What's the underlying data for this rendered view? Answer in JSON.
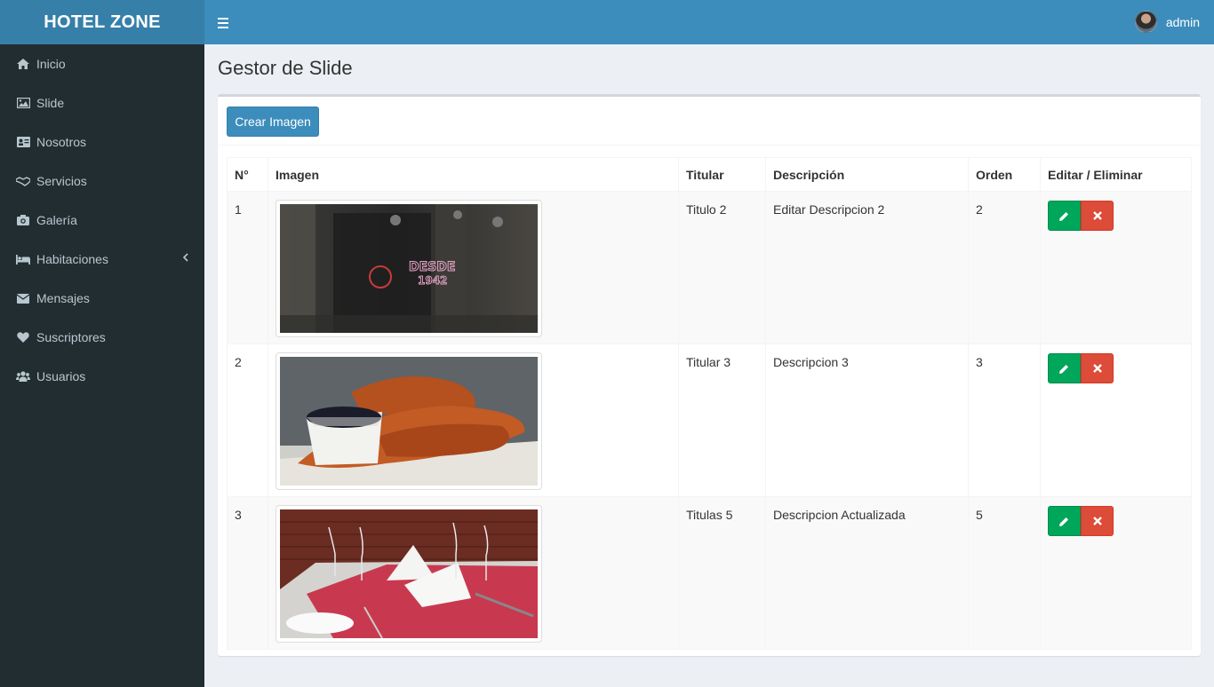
{
  "header": {
    "logo": "HOTEL ZONE",
    "user_name": "admin"
  },
  "sidebar": {
    "items": [
      {
        "label": "Inicio",
        "icon": "home-icon"
      },
      {
        "label": "Slide",
        "icon": "image-icon"
      },
      {
        "label": "Nosotros",
        "icon": "id-card-icon"
      },
      {
        "label": "Servicios",
        "icon": "handshake-icon"
      },
      {
        "label": "Galería",
        "icon": "camera-icon"
      },
      {
        "label": "Habitaciones",
        "icon": "bed-icon"
      },
      {
        "label": "Mensajes",
        "icon": "envelope-icon"
      },
      {
        "label": "Suscriptores",
        "icon": "heart-icon"
      },
      {
        "label": "Usuarios",
        "icon": "users-icon"
      }
    ]
  },
  "main": {
    "title": "Gestor de Slide",
    "create_button": "Crear Imagen",
    "table": {
      "headers": [
        "N°",
        "Imagen",
        "Titular",
        "Descripción",
        "Orden",
        "Editar / Eliminar"
      ],
      "rows": [
        {
          "num": "1",
          "title": "Titulo 2",
          "description": "Editar Descripcion 2",
          "order": "2",
          "image": "DESDE 1942"
        },
        {
          "num": "2",
          "title": "Titular 3",
          "description": "Descripcion 3",
          "order": "3",
          "image": ""
        },
        {
          "num": "3",
          "title": "Titulas 5",
          "description": "Descripcion Actualizada",
          "order": "5",
          "image": ""
        }
      ]
    }
  },
  "colors": {
    "header": "#3c8dbc",
    "logo_bg": "#367fa9",
    "sidebar": "#222d32",
    "edit": "#00a65a",
    "delete": "#dd4b39"
  }
}
